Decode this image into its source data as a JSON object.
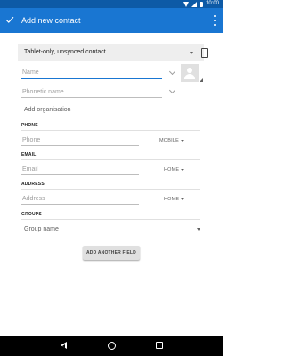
{
  "status_bar": {
    "time": "10:00",
    "icons": [
      "wifi-icon",
      "signal-icon",
      "battery-icon"
    ]
  },
  "app_bar": {
    "title": "Add new contact",
    "confirm_icon": "check-icon",
    "menu_icon": "more-vert-icon",
    "color": "#1976d2"
  },
  "account": {
    "label": "Tablet-only, unsynced contact",
    "icon": "tablet-icon"
  },
  "name_section": {
    "name_placeholder": "Name",
    "phonetic_placeholder": "Phonetic name",
    "add_organisation": "Add organisation"
  },
  "phone": {
    "header": "PHONE",
    "placeholder": "Phone",
    "type": "MOBILE"
  },
  "email": {
    "header": "EMAIL",
    "placeholder": "Email",
    "type": "HOME"
  },
  "address": {
    "header": "ADDRESS",
    "placeholder": "Address",
    "type": "HOME"
  },
  "groups": {
    "header": "GROUPS",
    "placeholder": "Group name"
  },
  "add_field_button": "ADD ANOTHER FIELD",
  "nav_bar": {
    "icons": [
      "back-icon",
      "home-icon",
      "recents-icon"
    ]
  }
}
